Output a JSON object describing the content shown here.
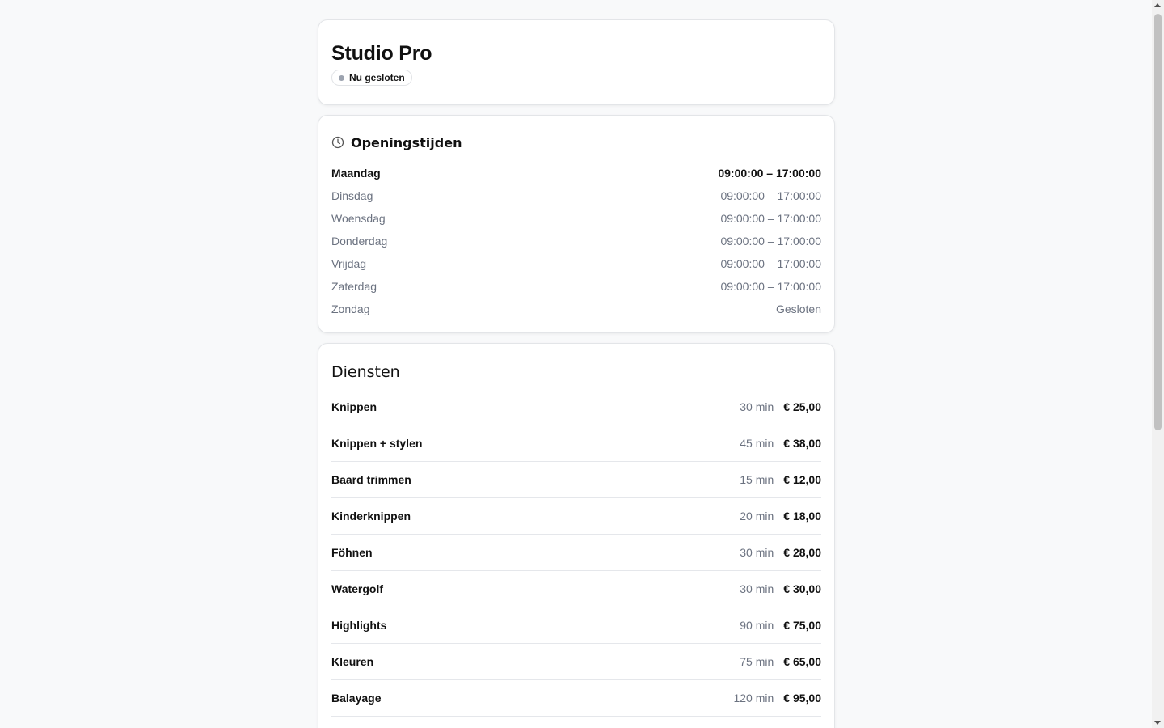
{
  "business": {
    "name": "Studio Pro",
    "status": "Nu gesloten",
    "status_color": "#9ca3af"
  },
  "hours": {
    "title": "Openingstijden",
    "icon": "clock-icon",
    "days": [
      {
        "day": "Maandag",
        "time": "09:00:00 – 17:00:00",
        "today": true
      },
      {
        "day": "Dinsdag",
        "time": "09:00:00 – 17:00:00",
        "today": false
      },
      {
        "day": "Woensdag",
        "time": "09:00:00 – 17:00:00",
        "today": false
      },
      {
        "day": "Donderdag",
        "time": "09:00:00 – 17:00:00",
        "today": false
      },
      {
        "day": "Vrijdag",
        "time": "09:00:00 – 17:00:00",
        "today": false
      },
      {
        "day": "Zaterdag",
        "time": "09:00:00 – 17:00:00",
        "today": false
      },
      {
        "day": "Zondag",
        "time": "Gesloten",
        "today": false
      }
    ]
  },
  "services": {
    "title": "Diensten",
    "items": [
      {
        "name": "Knippen",
        "duration": "30 min",
        "price": "€ 25,00"
      },
      {
        "name": "Knippen + stylen",
        "duration": "45 min",
        "price": "€ 38,00"
      },
      {
        "name": "Baard trimmen",
        "duration": "15 min",
        "price": "€ 12,00"
      },
      {
        "name": "Kinderknippen",
        "duration": "20 min",
        "price": "€ 18,00"
      },
      {
        "name": "Föhnen",
        "duration": "30 min",
        "price": "€ 28,00"
      },
      {
        "name": "Watergolf",
        "duration": "30 min",
        "price": "€ 30,00"
      },
      {
        "name": "Highlights",
        "duration": "90 min",
        "price": "€ 75,00"
      },
      {
        "name": "Kleuren",
        "duration": "75 min",
        "price": "€ 65,00"
      },
      {
        "name": "Balayage",
        "duration": "120 min",
        "price": "€ 95,00"
      }
    ]
  }
}
